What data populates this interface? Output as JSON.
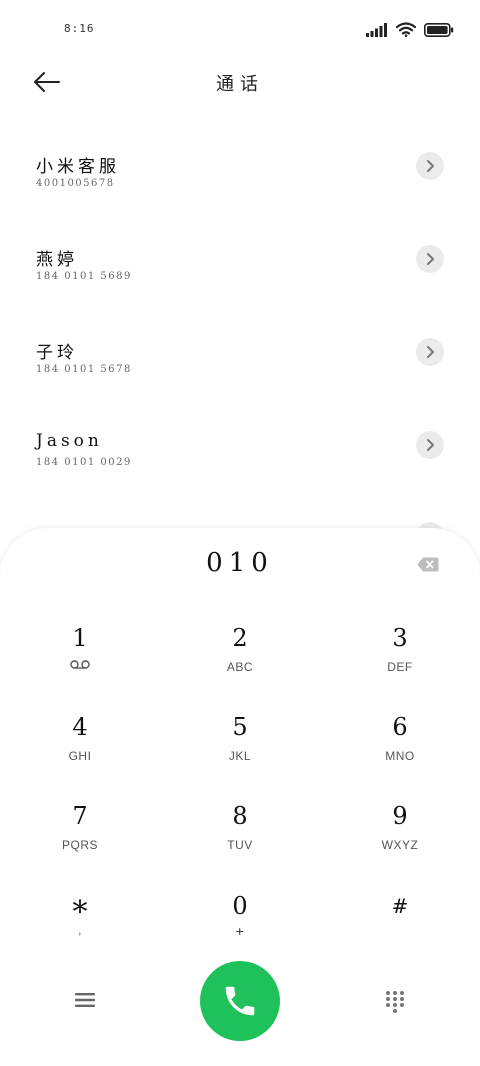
{
  "status": {
    "time": "8:16"
  },
  "header": {
    "title": "通话"
  },
  "contacts": [
    {
      "name": "小米客服",
      "number": "4001005678"
    },
    {
      "name": "燕婷",
      "number": "184 0101 5689"
    },
    {
      "name": "子玲",
      "number": "184 0101 5678"
    },
    {
      "name": "Jason",
      "number": "184 0101 0029"
    }
  ],
  "dialer": {
    "display": "010",
    "keys": [
      {
        "digit": "1",
        "letters": ""
      },
      {
        "digit": "2",
        "letters": "ABC"
      },
      {
        "digit": "3",
        "letters": "DEF"
      },
      {
        "digit": "4",
        "letters": "GHI"
      },
      {
        "digit": "5",
        "letters": "JKL"
      },
      {
        "digit": "6",
        "letters": "MNO"
      },
      {
        "digit": "7",
        "letters": "PQRS"
      },
      {
        "digit": "8",
        "letters": "TUV"
      },
      {
        "digit": "9",
        "letters": "WXYZ"
      },
      {
        "digit": "*",
        "letters": ","
      },
      {
        "digit": "0",
        "letters": "+"
      },
      {
        "digit": "#",
        "letters": ""
      }
    ]
  },
  "icons": {
    "back": "back-arrow-icon",
    "chevron": "chevron-right-icon",
    "delete": "backspace-icon",
    "voicemail": "voicemail-icon",
    "menu": "menu-icon",
    "call": "phone-icon",
    "keypad": "dialpad-icon"
  },
  "colors": {
    "call_button": "#1fc25a",
    "title_heart": "#e84a5f"
  }
}
